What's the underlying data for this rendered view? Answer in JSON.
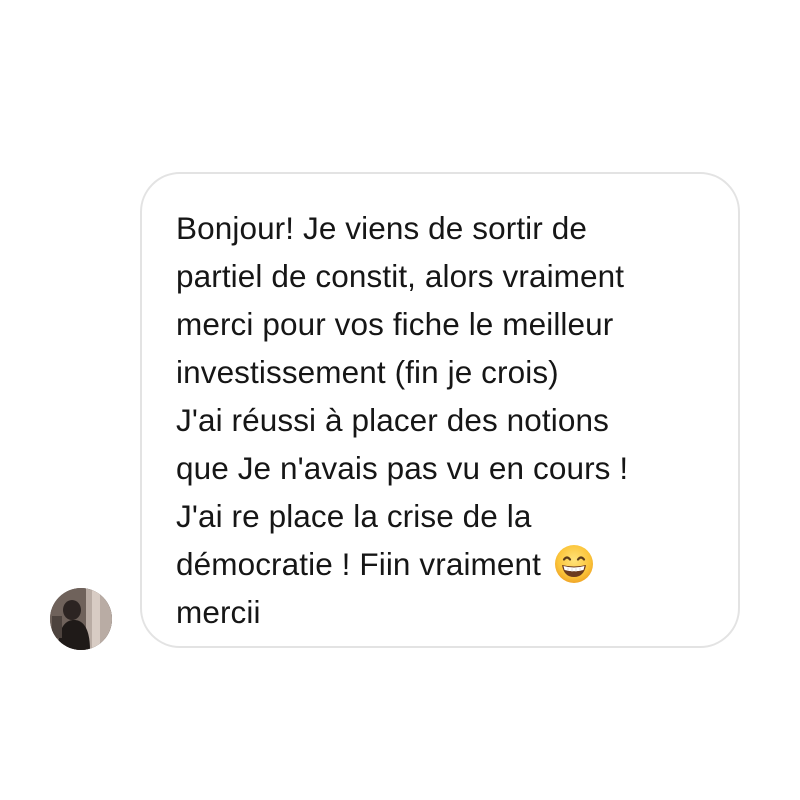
{
  "conversation": {
    "message": {
      "lines": [
        "Bonjour! Je viens de sortir de",
        "partiel de constit, alors vraiment",
        "merci pour vos fiche le meilleur",
        "investissement (fin je crois)",
        "J'ai réussi à placer des notions",
        "que Je n'avais pas vu en cours !",
        "J'ai re place la crise de la",
        "démocratie ! Fiin vraiment",
        "mercii"
      ],
      "emoji": "grinning-face-with-smiling-eyes-icon"
    },
    "sender": {
      "avatar_icon": "user-avatar-photo"
    }
  },
  "colors": {
    "bubble_border": "#e3e3e3",
    "text": "#161616",
    "background": "#ffffff"
  }
}
